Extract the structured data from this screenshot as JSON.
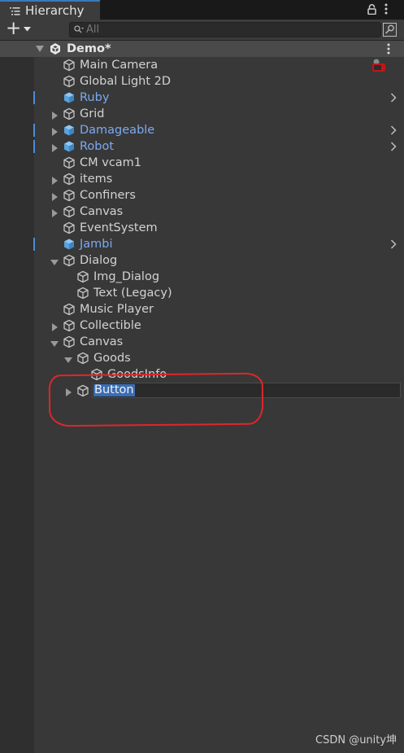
{
  "tab": {
    "title": "Hierarchy"
  },
  "toolbar": {
    "add_symbol": "+",
    "search_placeholder": "All"
  },
  "scene": {
    "title": "Demo*"
  },
  "rows": [
    {
      "label": "Main Camera",
      "level": 0,
      "fold": "none",
      "prefab": false,
      "chevron": false
    },
    {
      "label": "Global Light 2D",
      "level": 0,
      "fold": "none",
      "prefab": false,
      "chevron": false
    },
    {
      "label": "Ruby",
      "level": 0,
      "fold": "none",
      "prefab": true,
      "chevron": true
    },
    {
      "label": "Grid",
      "level": 0,
      "fold": "collapsed",
      "prefab": false,
      "chevron": false
    },
    {
      "label": "Damageable",
      "level": 0,
      "fold": "collapsed",
      "prefab": true,
      "chevron": true
    },
    {
      "label": "Robot",
      "level": 0,
      "fold": "collapsed",
      "prefab": true,
      "chevron": true
    },
    {
      "label": "CM vcam1",
      "level": 0,
      "fold": "none",
      "prefab": false,
      "chevron": false
    },
    {
      "label": "items",
      "level": 0,
      "fold": "collapsed",
      "prefab": false,
      "chevron": false
    },
    {
      "label": "Confiners",
      "level": 0,
      "fold": "collapsed",
      "prefab": false,
      "chevron": false
    },
    {
      "label": "Canvas",
      "level": 0,
      "fold": "collapsed",
      "prefab": false,
      "chevron": false
    },
    {
      "label": "EventSystem",
      "level": 0,
      "fold": "none",
      "prefab": false,
      "chevron": false
    },
    {
      "label": "Jambi",
      "level": 0,
      "fold": "none",
      "prefab": true,
      "chevron": true
    },
    {
      "label": "Dialog",
      "level": 0,
      "fold": "expanded",
      "prefab": false,
      "chevron": false
    },
    {
      "label": "Img_Dialog",
      "level": 1,
      "fold": "none",
      "prefab": false,
      "chevron": false
    },
    {
      "label": "Text (Legacy)",
      "level": 1,
      "fold": "none",
      "prefab": false,
      "chevron": false
    },
    {
      "label": "Music Player",
      "level": 0,
      "fold": "none",
      "prefab": false,
      "chevron": false
    },
    {
      "label": "Collectible",
      "level": 0,
      "fold": "collapsed",
      "prefab": false,
      "chevron": false
    },
    {
      "label": "Canvas",
      "level": 0,
      "fold": "expanded",
      "prefab": false,
      "chevron": false
    },
    {
      "label": "Goods",
      "level": 1,
      "fold": "expanded",
      "prefab": false,
      "chevron": false
    },
    {
      "label": "GoodsInfo",
      "level": 2,
      "fold": "none",
      "prefab": false,
      "chevron": false
    },
    {
      "label": "Button",
      "level": 1,
      "fold": "collapsed",
      "prefab": false,
      "chevron": false,
      "editing": true
    }
  ],
  "watermark": "CSDN @unity坤",
  "colors": {
    "background": "#383838",
    "gutter": "#2f2f2f",
    "scene_row": "#4a4a4a",
    "prefab_text": "#7baaf0",
    "selection": "#3a6db5",
    "annotation": "#e0262a"
  }
}
